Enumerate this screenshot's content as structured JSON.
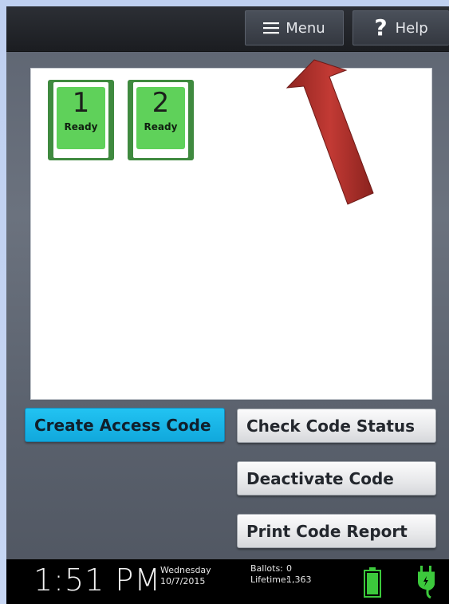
{
  "toolbar": {
    "menu_label": "Menu",
    "help_label": "Help"
  },
  "cards": [
    {
      "number": "1",
      "status": "Ready"
    },
    {
      "number": "2",
      "status": "Ready"
    }
  ],
  "actions": {
    "create_label": "Create Access Code",
    "check_label": "Check Code Status",
    "deactivate_label": "Deactivate Code",
    "print_label": "Print Code Report"
  },
  "status": {
    "time": "1:51 PM",
    "weekday": "Wednesday",
    "date": "10/7/2015",
    "ballots_label": "Ballots:",
    "ballots_value": "0",
    "lifetime_label": "Lifetime:",
    "lifetime_value": "1,363"
  },
  "icons": {
    "menu": "hamburger-icon",
    "help": "question-mark-icon",
    "battery": "battery-icon",
    "power": "power-plug-icon",
    "annotation": "red-arrow"
  },
  "colors": {
    "accent_blue": "#1bb6e9",
    "card_green": "#5fd15a",
    "battery_green": "#3cc93c",
    "arrow_red": "#b8322e"
  }
}
